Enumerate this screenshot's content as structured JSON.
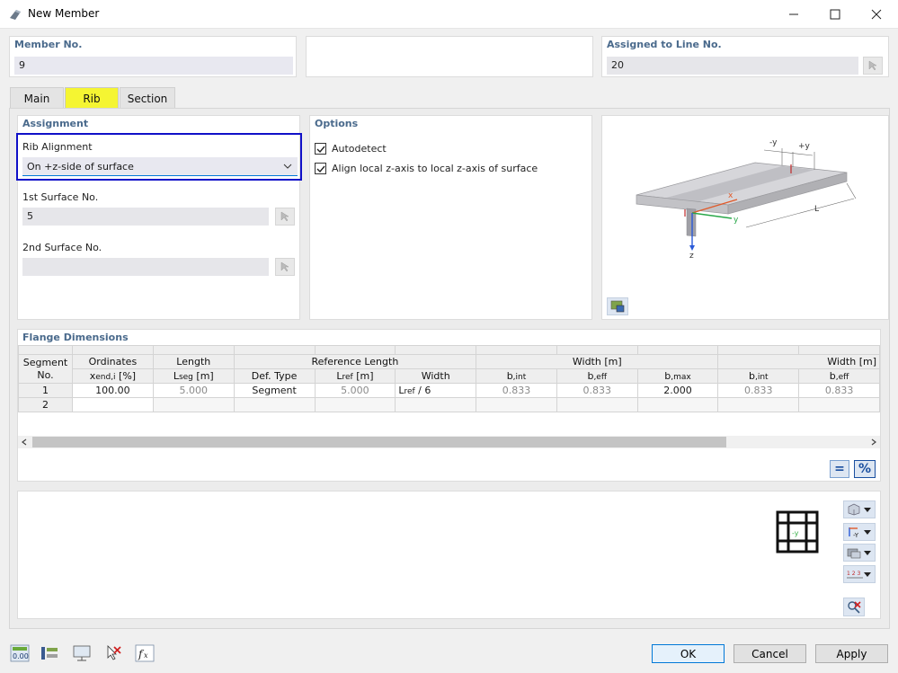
{
  "window": {
    "title": "New Member"
  },
  "member_no": {
    "label": "Member No.",
    "value": "9"
  },
  "assigned_line": {
    "label": "Assigned to Line No.",
    "value": "20"
  },
  "tabs": [
    {
      "label": "Main"
    },
    {
      "label": "Rib"
    },
    {
      "label": "Section"
    }
  ],
  "assignment": {
    "title": "Assignment",
    "rib_alignment_label": "Rib Alignment",
    "rib_alignment_value": "On +z-side of surface",
    "surface1_label": "1st Surface No.",
    "surface1_value": "5",
    "surface2_label": "2nd Surface No.",
    "surface2_value": ""
  },
  "options": {
    "title": "Options",
    "autodetect": "Autodetect",
    "align": "Align local z-axis to local z-axis of surface"
  },
  "diagram": {
    "minus_y": "-y",
    "plus_y": "+y",
    "x": "x",
    "y": "y",
    "z": "z",
    "L": "L"
  },
  "flange": {
    "title": "Flange Dimensions",
    "h_segment": "Segment",
    "h_no": "No.",
    "h_ordinates": "Ordinates",
    "h_xend": "x",
    "h_xend_sub": "end,i",
    "h_xend_unit": " [%]",
    "h_length": "Length",
    "h_lseg": "L",
    "h_lseg_sub": "seg",
    "h_lseg_unit": " [m]",
    "h_reflength": "Reference Length",
    "h_deftype": "Def. Type",
    "h_lref": "L",
    "h_lref_sub": "ref",
    "h_lref_unit": " [m]",
    "h_width": "Width",
    "h_width_m": "Width [m]",
    "h_width_m2": "Width [m]",
    "h_b": "b",
    "h_int": ",int",
    "h_eff": ",eff",
    "h_max": ",max",
    "rows": [
      {
        "no": "1",
        "x": "100.00",
        "lseg": "5.000",
        "deftype": "Segment",
        "lref": "5.000",
        "width": "L",
        "width_sub": "ref",
        "width_rest": " / 6",
        "b_int": "0.833",
        "b_eff": "0.833",
        "b_max": "2.000",
        "b2_int": "0.833",
        "b2_eff": "0.833"
      },
      {
        "no": "2",
        "x": "",
        "lseg": "",
        "deftype": "",
        "lref": "",
        "width": "",
        "width_sub": "",
        "width_rest": "",
        "b_int": "",
        "b_eff": "",
        "b_max": "",
        "b2_int": "",
        "b2_eff": ""
      }
    ]
  },
  "unit_buttons": {
    "equals": "=",
    "percent": "%"
  },
  "section_icon_label": "-y",
  "numbering_icon_label": "1 2 3",
  "toolbar_value_icon": "0.00",
  "buttons": {
    "ok": "OK",
    "cancel": "Cancel",
    "apply": "Apply"
  },
  "colors": {
    "accent": "#0078d7",
    "active_tab": "#f5f532",
    "highlight": "#1010c8",
    "label": "#4a6a8c"
  }
}
